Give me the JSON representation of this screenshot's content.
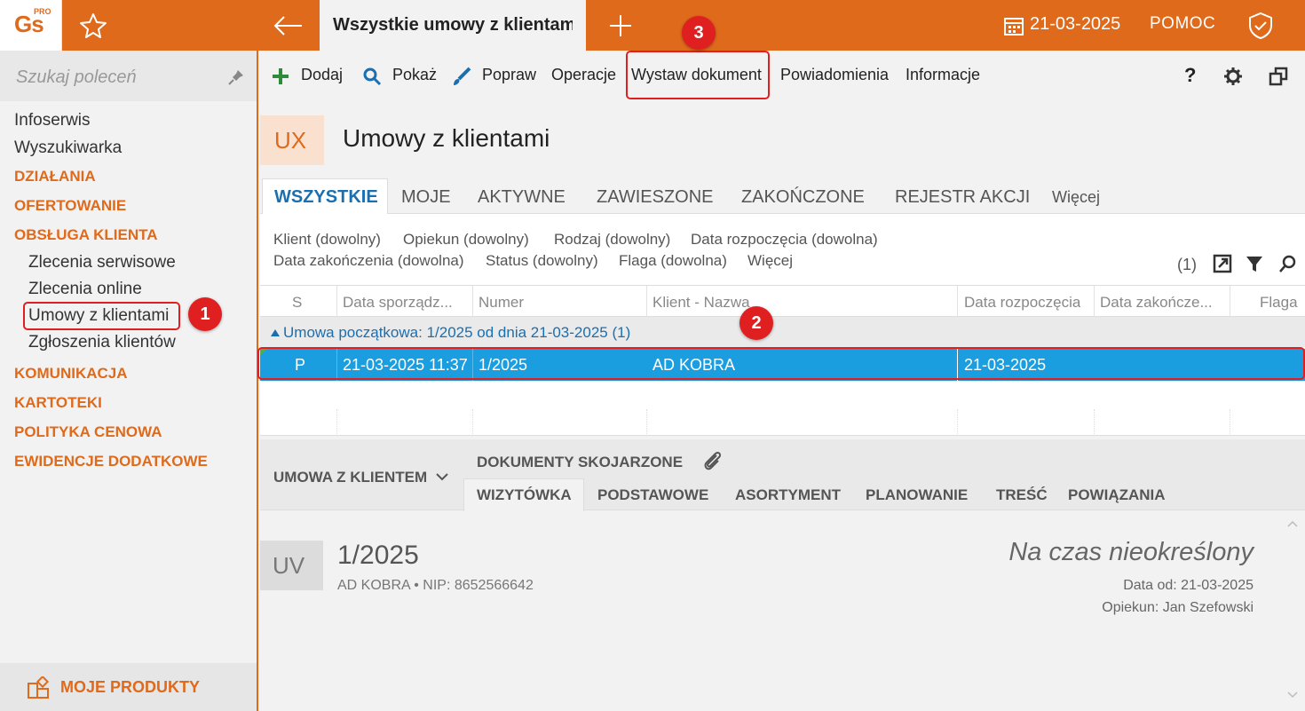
{
  "app": {
    "logo_text": "Gs",
    "logo_pro": "PRO",
    "tab_title": "Wszystkie umowy z klientami",
    "date": "21-03-2025",
    "help": "POMOC"
  },
  "sidebar": {
    "search_placeholder": "Szukaj poleceń",
    "items": [
      {
        "label": "Infoserwis",
        "type": "item"
      },
      {
        "label": "Wyszukiwarka",
        "type": "item"
      },
      {
        "label": "DZIAŁANIA",
        "type": "category"
      },
      {
        "label": "OFERTOWANIE",
        "type": "category"
      },
      {
        "label": "OBSŁUGA KLIENTA",
        "type": "category"
      },
      {
        "label": "Zlecenia serwisowe",
        "type": "sub"
      },
      {
        "label": "Zlecenia online",
        "type": "sub"
      },
      {
        "label": "Umowy z klientami",
        "type": "sub"
      },
      {
        "label": "Zgłoszenia klientów",
        "type": "sub"
      },
      {
        "label": "KOMUNIKACJA",
        "type": "category"
      },
      {
        "label": "KARTOTEKI",
        "type": "category"
      },
      {
        "label": "POLITYKA CENOWA",
        "type": "category"
      },
      {
        "label": "EWIDENCJE DODATKOWE",
        "type": "category"
      }
    ],
    "footer": "MOJE PRODUKTY"
  },
  "toolbar": {
    "add": "Dodaj",
    "show": "Pokaż",
    "edit": "Popraw",
    "operations": "Operacje",
    "issue_document": "Wystaw dokument",
    "notifications": "Powiadomienia",
    "information": "Informacje",
    "help_q": "?"
  },
  "page": {
    "badge": "UX",
    "title": "Umowy z klientami"
  },
  "tabs": [
    "WSZYSTKIE",
    "MOJE",
    "AKTYWNE",
    "ZAWIESZONE",
    "ZAKOŃCZONE",
    "REJESTR AKCJI",
    "Więcej"
  ],
  "filters": {
    "row1": [
      "Klient (dowolny)",
      "Opiekun (dowolny)",
      "Rodzaj (dowolny)",
      "Data rozpoczęcia (dowolna)"
    ],
    "row2": [
      "Data zakończenia (dowolna)",
      "Status (dowolny)",
      "Flaga (dowolna)",
      "Więcej"
    ],
    "count": "(1)"
  },
  "grid": {
    "columns": [
      "S",
      "Data sporządz...",
      "Numer",
      "Klient - Nazwa",
      "Data rozpoczęcia",
      "Data zakończe...",
      "Flaga"
    ],
    "group_label": "Umowa początkowa: 1/2025 od dnia 21-03-2025",
    "group_count": "(1)",
    "rows": [
      {
        "s": "P",
        "date": "21-03-2025 11:37",
        "number": "1/2025",
        "client": "AD KOBRA",
        "start": "21-03-2025",
        "end": "",
        "flag": ""
      }
    ]
  },
  "detail": {
    "section": "UMOWA Z KLIENTEM",
    "linked_docs": "DOKUMENTY SKOJARZONE",
    "tabs": [
      "WIZYTÓWKA",
      "PODSTAWOWE",
      "ASORTYMENT",
      "PLANOWANIE",
      "TREŚĆ",
      "POWIĄZANIA"
    ],
    "badge": "UV",
    "number": "1/2025",
    "client_line": "AD KOBRA  •  NIP: 8652566642",
    "period": "Na czas nieokreślony",
    "date_from": "Data od: 21-03-2025",
    "keeper": "Opiekun: Jan Szefowski"
  },
  "annotations": [
    "1",
    "2",
    "3"
  ],
  "colors": {
    "brand_orange": "#e06a1b",
    "selection_blue": "#1a9ee0",
    "link_blue": "#1a6fb0",
    "annotation_red": "#e02020"
  }
}
